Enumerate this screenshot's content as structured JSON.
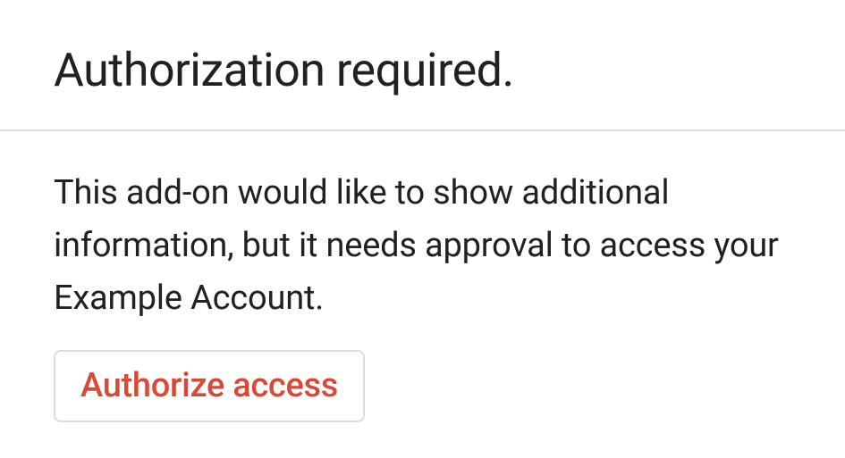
{
  "header": {
    "title": "Authorization required."
  },
  "content": {
    "description": "This add-on would like to show additional information, but it needs approval to access your Example Account.",
    "authorize_label": "Authorize access"
  }
}
